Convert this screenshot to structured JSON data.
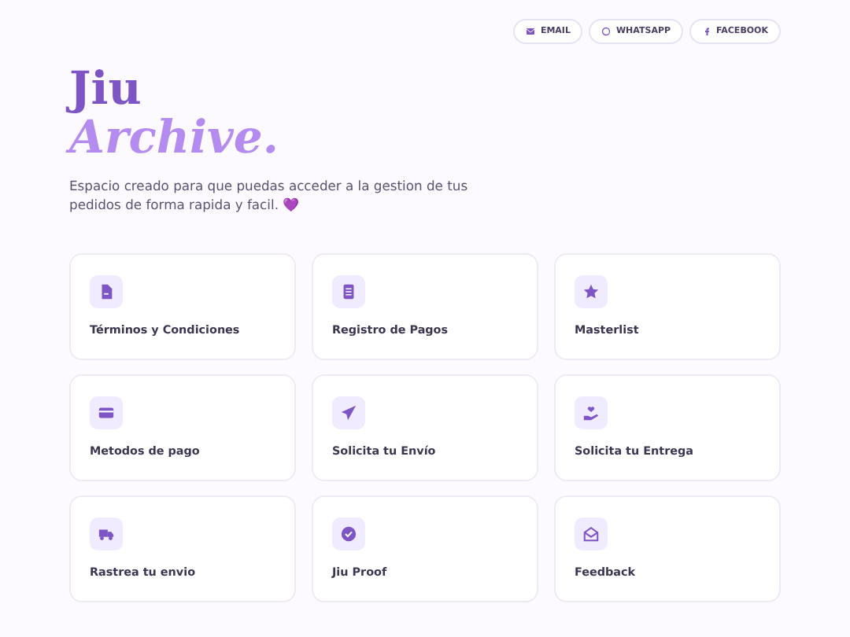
{
  "contact_buttons": [
    {
      "label": "EMAIL"
    },
    {
      "label": "WHATSAPP"
    },
    {
      "label": "FACEBOOK"
    }
  ],
  "title": {
    "line_1": "Jiu",
    "line_2": "Archive."
  },
  "description": "Espacio creado para que puedas acceder a la gestion de tus pedidos de forma rapida y facil. 💜",
  "cards": [
    {
      "label": "Términos y Condiciones"
    },
    {
      "label": "Registro de Pagos"
    },
    {
      "label": "Masterlist"
    },
    {
      "label": "Metodos de pago"
    },
    {
      "label": "Solicita tu Envío"
    },
    {
      "label": "Solicita tu Entrega"
    },
    {
      "label": "Rastrea tu envio"
    },
    {
      "label": "Jiu Proof"
    },
    {
      "label": "Feedback"
    }
  ]
}
